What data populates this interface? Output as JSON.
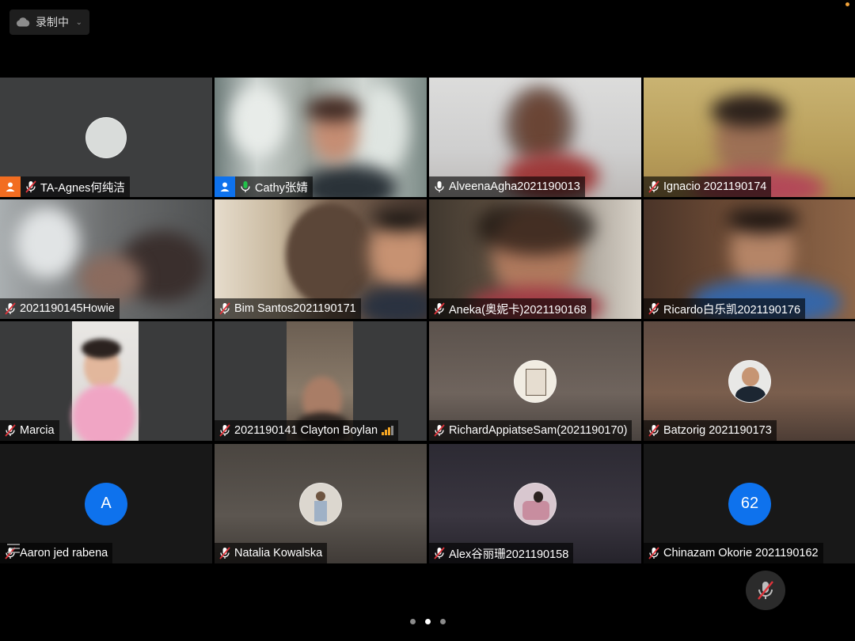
{
  "recording": {
    "label": "录制中",
    "icon": "cloud-icon"
  },
  "pager": {
    "pages": 3,
    "current": 2
  },
  "colors": {
    "active_speaker": "#21c24a",
    "avatar_blue": "#0e72ed",
    "host_badge": "#f26d21",
    "cohost_badge": "#0e72ed",
    "signal": "#f5a623"
  },
  "participants": [
    {
      "name": "TA-Agnes何纯洁",
      "muted": true,
      "badge": "host"
    },
    {
      "name": "Cathy张婧",
      "muted": false,
      "badge": "cohost",
      "active": true
    },
    {
      "name": "AlveenaAgha2021190013",
      "muted": false
    },
    {
      "name": "Ignacio 2021190174",
      "muted": true
    },
    {
      "name": "2021190145Howie",
      "muted": true
    },
    {
      "name": "Bim Santos2021190171",
      "muted": true
    },
    {
      "name": "Aneka(奥妮卡)2021190168",
      "muted": true
    },
    {
      "name": "Ricardo白乐凯2021190176",
      "muted": true
    },
    {
      "name": "Marcia",
      "muted": true
    },
    {
      "name": "2021190141 Clayton Boylan",
      "muted": true,
      "signal": "weak"
    },
    {
      "name": "RichardAppiatseSam(2021190170)",
      "muted": true
    },
    {
      "name": "Batzorig 2021190173",
      "muted": true
    },
    {
      "name": "Aaron jed rabena",
      "muted": true,
      "avatar_letter": "A"
    },
    {
      "name": "Natalia Kowalska",
      "muted": true
    },
    {
      "name": "Alex谷丽珊2021190158",
      "muted": true
    },
    {
      "name": "Chinazam Okorie 2021190162",
      "muted": true,
      "avatar_letter": "62"
    }
  ]
}
